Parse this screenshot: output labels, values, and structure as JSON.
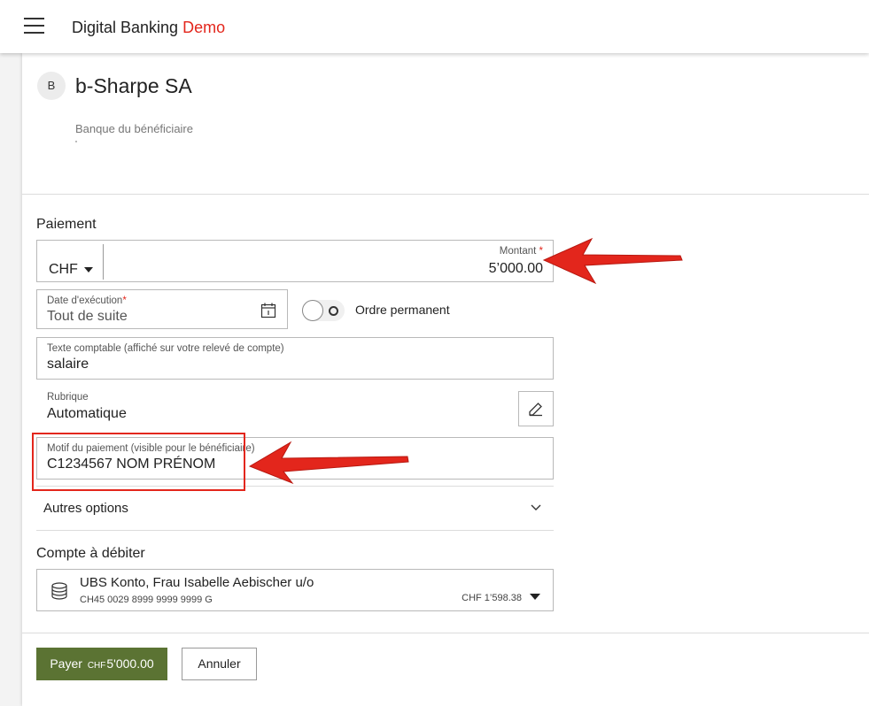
{
  "app": {
    "title_main": "Digital Banking",
    "title_accent": "Demo",
    "accent_color": "#e3261c"
  },
  "payee": {
    "initial": "B",
    "name": "b-Sharpe SA",
    "bank_label": "Banque du bénéficiaire"
  },
  "payment": {
    "section_label": "Paiement",
    "currency": "CHF",
    "amount_label": "Montant",
    "amount_required_mark": "*",
    "amount_value": "5’000.00",
    "execution_label": "Date d'exécution",
    "execution_required_mark": "*",
    "execution_value": "Tout de suite",
    "standing_order_label": "Ordre permanent",
    "standing_order_on": false,
    "booking_text_label": "Texte comptable (affiché sur votre relevé de compte)",
    "booking_text_value": "salaire",
    "category_label": "Rubrique",
    "category_value": "Automatique",
    "reference_label": "Motif du paiement (visible pour le bénéficiaire)",
    "reference_value": "C1234567 NOM PRÉNOM",
    "more_options_label": "Autres options"
  },
  "debit": {
    "section_label": "Compte à débiter",
    "account_name": "UBS Konto, Frau Isabelle Aebischer u/o",
    "account_iban": "CH45 0029 8999 9999 9999 G",
    "account_balance": "CHF  1’598.38"
  },
  "actions": {
    "pay_label": "Payer",
    "pay_currency": "CHF",
    "pay_amount": "5'000.00",
    "cancel_label": "Annuler",
    "pay_color": "#5b7333"
  },
  "annotations": {
    "color": "#e3261c"
  }
}
